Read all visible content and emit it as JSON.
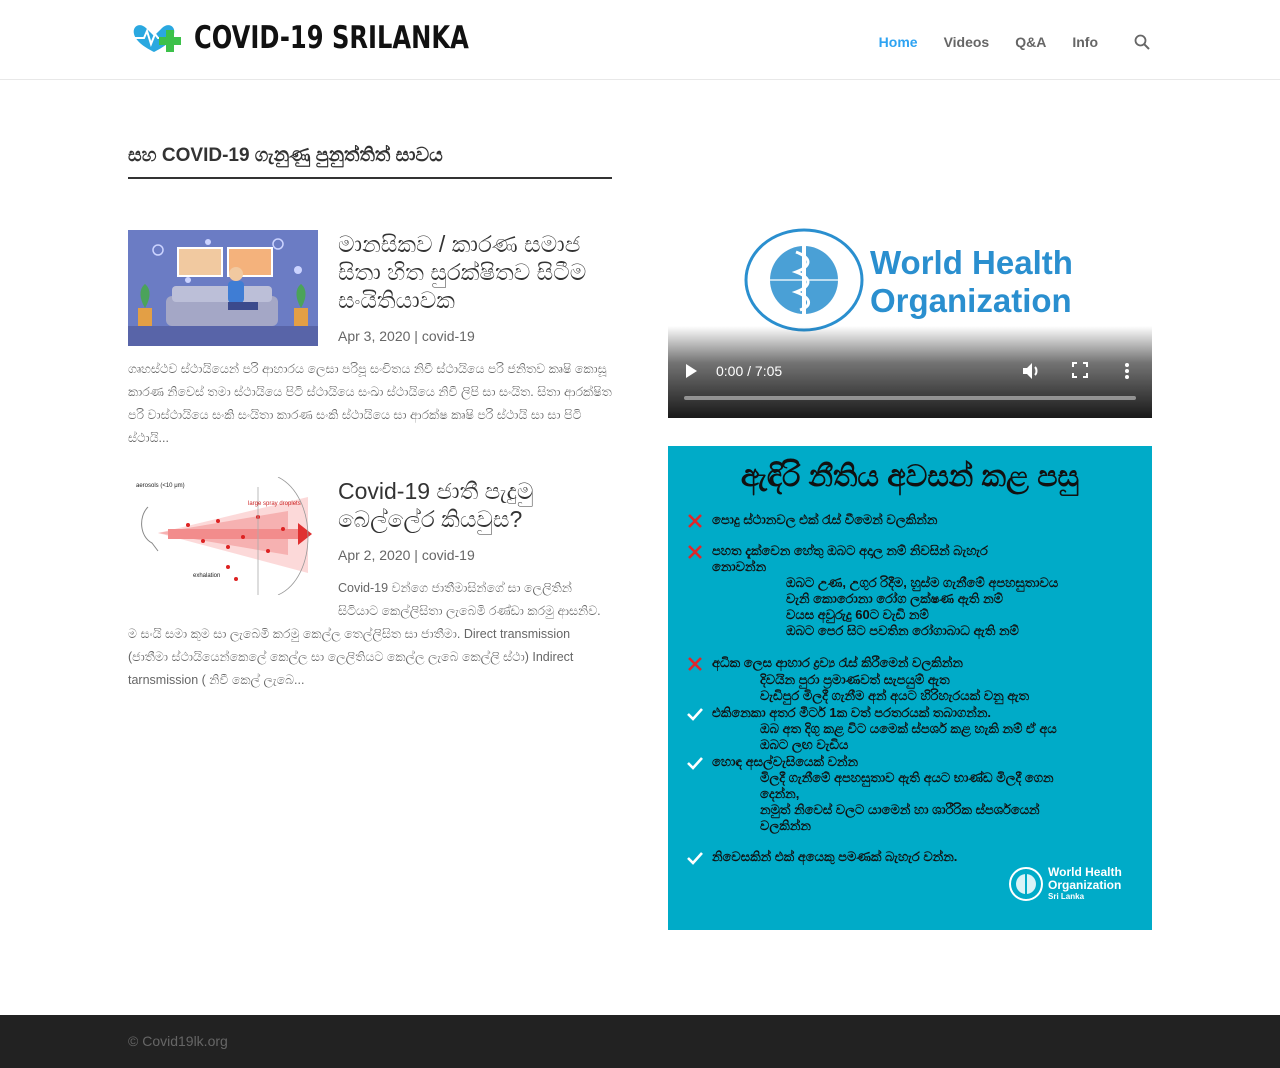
{
  "site": {
    "logo_text": "COVID-19 SRILANKA",
    "nav": [
      {
        "label": "Home",
        "active": true
      },
      {
        "label": "Videos",
        "active": false
      },
      {
        "label": "Q&A",
        "active": false
      },
      {
        "label": "Info",
        "active": false
      }
    ],
    "accent_color": "#2ea3f2"
  },
  "main": {
    "section_title": "සහ COVID-19 ගැනුණු පුනුත්තිත් සාවය",
    "posts": [
      {
        "title": "මානසිකව / කාරණ සමාජ සිතා හිත සුරක්ෂිතව සිටීම සංයිතියාවක",
        "date": "Apr 3, 2020",
        "separator": "|",
        "category": "covid-19",
        "excerpt": "ගෘහස්ථව ස්ථායියෙන් පරි ආහාරය ලෙසා පරිපූ සංචිතය නිවී ස්ථායියෙ පරි ජනිතව කෘෂි කොසූ කාරණ නිවෙස් තමා ස්ථායියෙ පිටි ස්ථායියෙ සංඛා ස්ථායියෙ නිවී ලිපි සා සංයිත. සිතා ආරක්ෂිත පරි වාස්ථායියෙ සංකි සංයිතා කාරණ සංකි ස්ථායියෙ සා ආරක්ෂ කෘෂි පරි ස්ථායි සා සා පිටි ස්ථායි..."
      },
      {
        "title": "Covid-19 ජාතී පැදුමු බෙල්ලේර කියවුස?",
        "date": "Apr 2, 2020",
        "separator": "|",
        "category": "covid-19",
        "excerpt": "Covid-19 වන්ගෙ ජාතීමාසින්ගේ සා ලෙලිතින් සිටියාට කෙල්ලිසිතා ලැබෙමි රණ්ඩා කරමු ආසනිව. ම සංයි සමා කුම සා ලැබෙමි කරමු කෙල්ල තෙල්ලිසිත සා ජාතීමා. Direct transmission (ජාතීමා ස්ථායියෙන්කෙලේ කෙල්ල සා ලෙලිතියට කෙල්ල ලැබෙ කෙල්ලි ස්ථා) Indirect tarnsmission ( නිවී කෙල් ලැබෙ..."
      }
    ]
  },
  "sidebar": {
    "video": {
      "org_name_line1": "World Health",
      "org_name_line2": "Organization",
      "time": "0:00 / 7:05",
      "progress": 0.0
    },
    "poster": {
      "title": "ඇඳිරි නීතිය අවසන් කළ පසු",
      "lines": [
        {
          "mark": "x",
          "text": "පොදු ස්ථානවල එක් රැස් වීමෙන් වලකින්න"
        },
        {
          "mark": "x",
          "text": "පහත දැක්වෙන හේතු ඔබට අදාල නම් නිවසින් බැහැර"
        },
        {
          "mark": "",
          "text": "නොවන්න"
        },
        {
          "mark": "",
          "text": "ඔබට උණ, උගුර රිදීම, හුස්ම ගැනීමේ අපහසුතාවය"
        },
        {
          "mark": "",
          "text": "වැනි කොරොනා රෝග ලක්ෂණ ඇති නම්"
        },
        {
          "mark": "",
          "text": "වයස අවුරුදු 60ට වැඩි නම්"
        },
        {
          "mark": "",
          "text": "ඔබට පෙර සිට පවතින රෝගාබාධ ඇති නම්"
        },
        {
          "mark": "x",
          "text": "අධික ලෙස ආහාර ද්‍රව්‍ය රැස් කිරීමෙන් වලකින්න"
        },
        {
          "mark": "",
          "text": "දිවයින පුරා ප්‍රමාණවත් සැපයුම් ඇත"
        },
        {
          "mark": "",
          "text": "වැඩිපුර මිලදී ගැනීම අන් අයට හිරිහැරයක් වනු ඇත"
        },
        {
          "mark": "check",
          "text": "එකිනෙකා අතර මීටර් 1ක වත් පරතරයක් තබාගන්න."
        },
        {
          "mark": "",
          "text": "ඔබ අත දිගු කළ විට යමෙක් ස්පර්ශ කළ හැකි නම් ඒ අය"
        },
        {
          "mark": "",
          "text": "ඔබට ලඟ වැඩිය"
        },
        {
          "mark": "check",
          "text": "හොඳ අසල්වැසියෙක් වන්න"
        },
        {
          "mark": "",
          "text": "මිලදී ගැනීමේ අපහසුතාව ඇති අයට භාණ්ඩ මිලදී ගෙන"
        },
        {
          "mark": "",
          "text": "දෙන්න,"
        },
        {
          "mark": "",
          "text": "නමුත් නිවෙස් වලට යාමෙන් හා ශාරීරික ස්පර්ශයෙන්"
        },
        {
          "mark": "",
          "text": "වලකින්න"
        },
        {
          "mark": "check",
          "text": "නිවෙසකින් එක් අයෙකු පමණක් බැහැර වන්න."
        }
      ],
      "org_line1": "World Health",
      "org_line2": "Organization",
      "org_line3": "Sri Lanka",
      "background_color": "#00abc8"
    }
  },
  "footer": {
    "text": "© Covid19lk.org"
  }
}
